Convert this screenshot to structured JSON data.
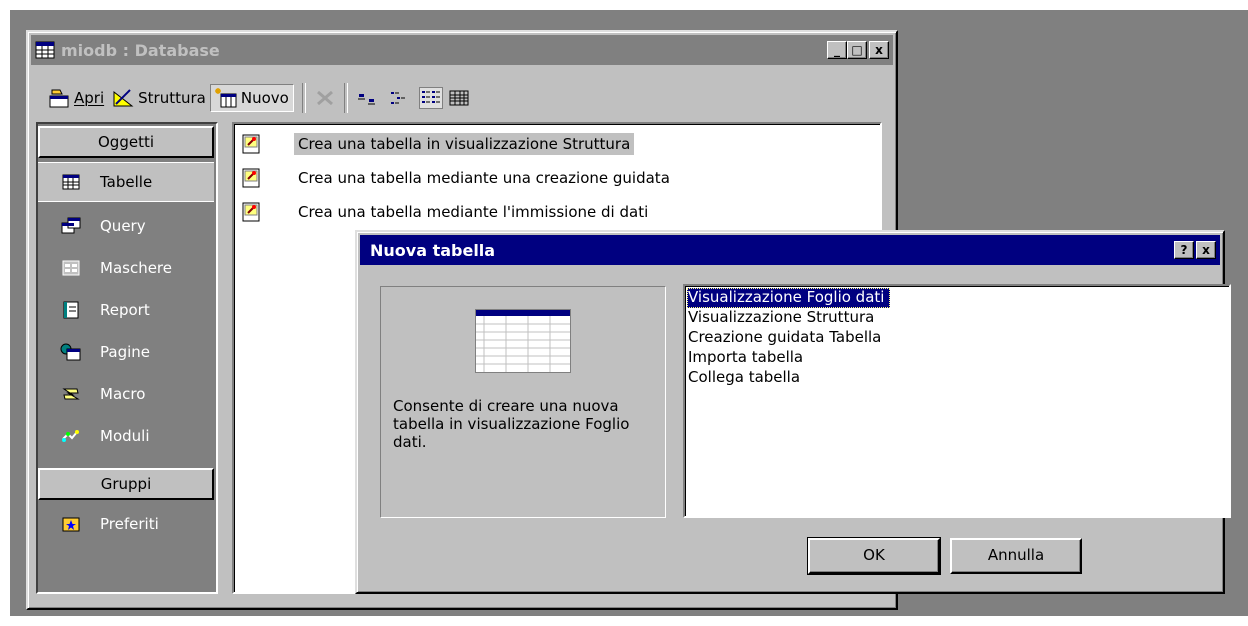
{
  "db_window": {
    "title": "miodb : Database",
    "controls": {
      "minimize": "_",
      "maximize": "□",
      "close": "x"
    }
  },
  "toolbar": {
    "open_label": "Apri",
    "design_label": "Struttura",
    "new_label": "Nuovo",
    "icons": [
      "delete-icon",
      "large-icons-icon",
      "small-icons-icon",
      "list-view-icon",
      "details-view-icon"
    ]
  },
  "objects_bar": {
    "objects_header": "Oggetti",
    "groups_header": "Gruppi",
    "items": [
      {
        "label": "Tabelle",
        "icon": "table-icon",
        "selected": true
      },
      {
        "label": "Query",
        "icon": "query-icon"
      },
      {
        "label": "Maschere",
        "icon": "form-icon"
      },
      {
        "label": "Report",
        "icon": "report-icon"
      },
      {
        "label": "Pagine",
        "icon": "page-icon"
      },
      {
        "label": "Macro",
        "icon": "macro-icon"
      },
      {
        "label": "Moduli",
        "icon": "module-icon"
      }
    ],
    "groups": [
      {
        "label": "Preferiti",
        "icon": "favorites-icon"
      }
    ]
  },
  "object_list": [
    "Crea una tabella in visualizzazione Struttura",
    "Crea una tabella mediante una creazione guidata",
    "Crea una tabella mediante l'immissione di dati"
  ],
  "dialog": {
    "title": "Nuova tabella",
    "help_label": "?",
    "close_label": "x",
    "description": "Consente di creare una nuova tabella in visualizzazione Foglio dati.",
    "options": [
      "Visualizzazione Foglio dati",
      "Visualizzazione Struttura",
      "Creazione guidata Tabella",
      "Importa tabella",
      "Collega tabella"
    ],
    "selected_option": "Visualizzazione Foglio dati",
    "ok_label": "OK",
    "cancel_label": "Annulla"
  },
  "colors": {
    "desktop": "#808080",
    "face": "#c0c0c0",
    "active_title": "#000080",
    "inactive_title": "#808080"
  }
}
